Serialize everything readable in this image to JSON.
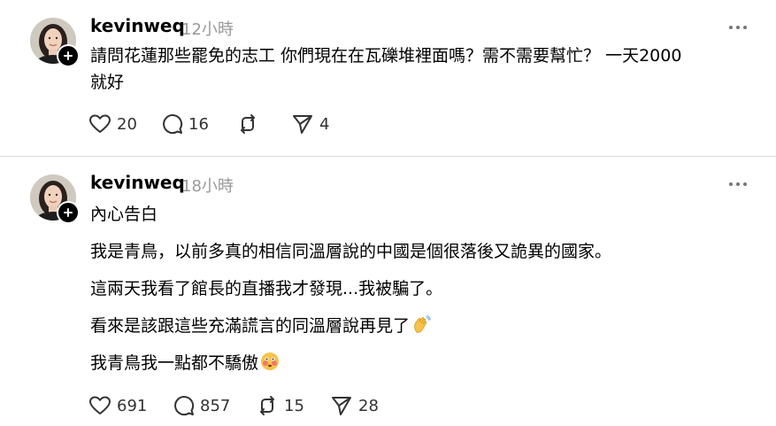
{
  "posts": [
    {
      "username": "kevinweq",
      "time": "12小時",
      "lines": [
        "請問花蓮那些罷免的志工 你們現在在瓦礫堆裡面嗎？需不需要幫忙？ 一天2000",
        "就好"
      ],
      "likes": "20",
      "comments": "16",
      "reposts": "",
      "shares": "4"
    },
    {
      "username": "kevinweq",
      "time": "18小時",
      "lines": [
        "內心告白",
        "我是青鳥，以前多真的相信同溫層說的中國是個很落後又詭異的國家。",
        "這兩天我看了館長的直播我才發現...我被騙了。",
        "看來是該跟這些充滿謊言的同溫層說再見了",
        "我青鳥我一點都不驕傲"
      ],
      "line_emojis": [
        "",
        "",
        "",
        "waving-hand-emoji",
        "flushed-face-emoji"
      ],
      "likes": "691",
      "comments": "857",
      "reposts": "15",
      "shares": "28"
    }
  ],
  "icons": {
    "like": "heart-icon",
    "comment": "comment-bubble-icon",
    "repost": "repost-arrows-icon",
    "share": "send-paper-plane-icon",
    "more": "more-options-icon",
    "follow": "plus-icon"
  },
  "colors": {
    "text": "#000000",
    "muted": "#999999",
    "icon": "#333333",
    "divider": "#d9d9d9"
  }
}
